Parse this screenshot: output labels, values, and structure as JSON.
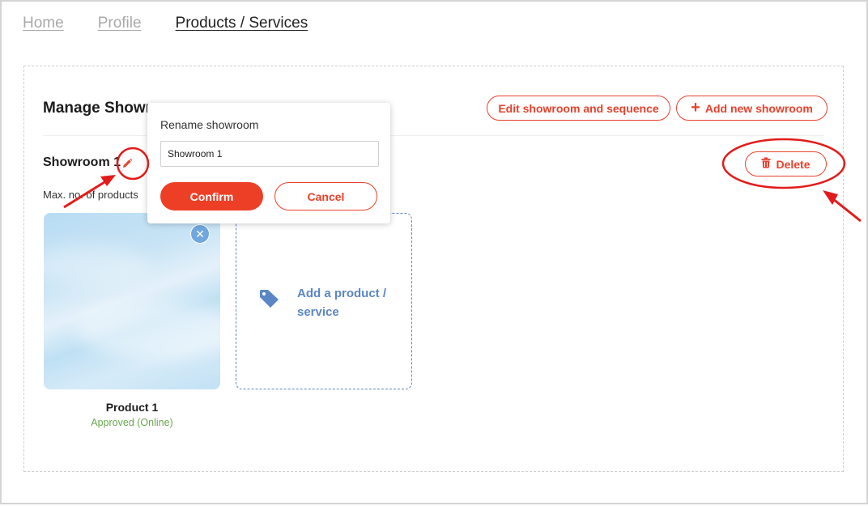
{
  "nav": {
    "items": [
      {
        "label": "Home"
      },
      {
        "label": "Profile"
      },
      {
        "label": "Products / Services"
      }
    ]
  },
  "panel": {
    "title": "Manage Showr",
    "edit_button": "Edit showroom and sequence",
    "add_button": "Add new showroom"
  },
  "showroom": {
    "name": "Showroom 1",
    "max_products_label": "Max. no. of products",
    "delete_label": "Delete"
  },
  "products": [
    {
      "name": "Product 1",
      "status": "Approved (Online)"
    }
  ],
  "add_product": {
    "label": "Add a product / service"
  },
  "rename_popup": {
    "title": "Rename showroom",
    "input_value": "Showroom 1",
    "confirm_label": "Confirm",
    "cancel_label": "Cancel"
  },
  "colors": {
    "accent": "#e8412c",
    "link_blue": "#5b86c5",
    "approved_green": "#6aa84f",
    "annotation_red": "#e31b1b"
  },
  "icons": [
    "pencil-icon",
    "trash-icon",
    "plus-icon",
    "tag-icon",
    "close-icon"
  ]
}
